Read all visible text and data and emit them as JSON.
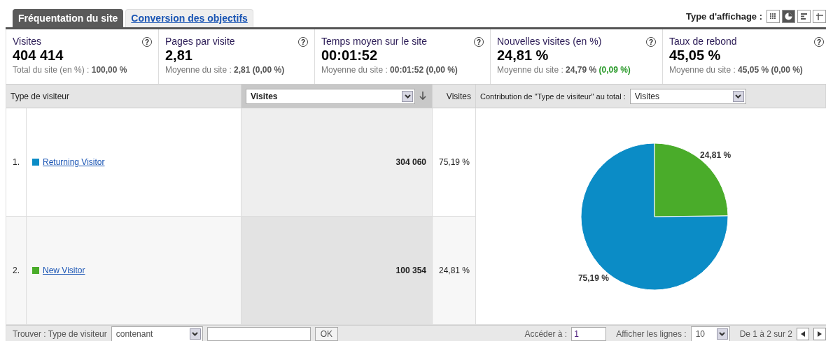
{
  "tabs": [
    {
      "label": "Fréquentation du site",
      "selected": true
    },
    {
      "label": "Conversion des objectifs",
      "selected": false
    }
  ],
  "view_type": {
    "label": "Type d'affichage :",
    "options": [
      {
        "kind": "grid",
        "selected": false
      },
      {
        "kind": "pie",
        "selected": true
      },
      {
        "kind": "bars",
        "selected": false
      },
      {
        "kind": "pivot",
        "selected": false
      }
    ]
  },
  "metrics": [
    {
      "title": "Visites",
      "help": "?",
      "value": "404 414",
      "note": "Total du site (en %) :",
      "note_value": "100,00 %"
    },
    {
      "title": "Pages par visite",
      "help": "?",
      "value": "2,81",
      "note": "Moyenne du site :",
      "note_value": "2,81",
      "change": "(0,00 %)",
      "color": "#555555"
    },
    {
      "title": "Temps moyen sur le site",
      "help": "?",
      "value": "00:01:52",
      "note": "Moyenne du site :",
      "note_value": "00:01:52",
      "change": "(0,00 %)",
      "color": "#555555"
    },
    {
      "title": "Nouvelles visites (en %)",
      "help": "?",
      "value": "24,81 %",
      "note": "Moyenne du site :",
      "note_value": "24,79 %",
      "change": "(0,09 %)",
      "color": "#2a9a2a"
    },
    {
      "title": "Taux de rebond",
      "help": "?",
      "value": "45,05 %",
      "note": "Moyenne du site :",
      "note_value": "45,05 %",
      "change": "(0,00 %)",
      "color": "#555555"
    }
  ],
  "table": {
    "dimension_header": "Type de visiteur",
    "metric_select": "Visites",
    "percent_header": "Visites",
    "contribution_label": "Contribution de \"Type de visiteur\" au total :",
    "contribution_select": "Visites",
    "rows": [
      {
        "index": "1.",
        "name": "Returning Visitor",
        "color": "#0b8cc6",
        "visits": "304 060",
        "percent": "75,19 %"
      },
      {
        "index": "2.",
        "name": "New Visitor",
        "color": "#4aac2a",
        "visits": "100 354",
        "percent": "24,81 %"
      }
    ],
    "chart_data": {
      "type": "pie",
      "values": [
        75.19,
        24.81
      ],
      "value_labels": [
        "75,19 %",
        "24,81 %"
      ]
    }
  },
  "footer": {
    "find_label": "Trouver : Type de visiteur",
    "match_select": "contenant",
    "ok": "OK",
    "goto_label": "Accéder à :",
    "goto_value": "1",
    "rows_label": "Afficher les lignes :",
    "rows_value": "10",
    "range": "De 1 à 2 sur 2"
  }
}
